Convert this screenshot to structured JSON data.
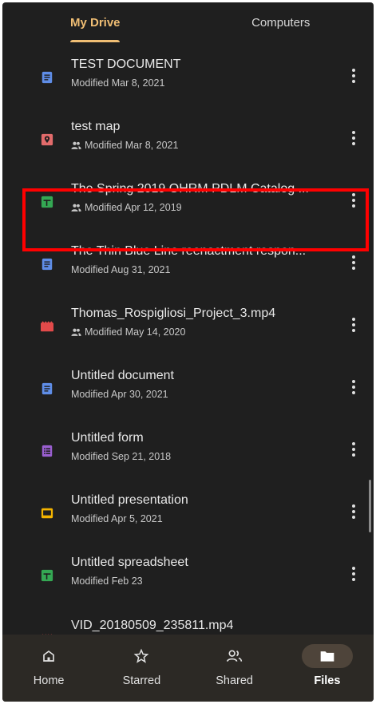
{
  "tabs": [
    {
      "label": "My Drive",
      "active": true
    },
    {
      "label": "Computers",
      "active": false
    }
  ],
  "files": [
    {
      "title": "TEST DOCUMENT",
      "meta": "Modified Mar 8, 2021",
      "shared": false,
      "type": "doc",
      "icon": "docs-icon"
    },
    {
      "title": "test map",
      "meta": "Modified Mar 8, 2021",
      "shared": true,
      "type": "map",
      "icon": "map-pin-icon"
    },
    {
      "title": "The Spring 2019 OHRM PDLM Catalog ...",
      "meta": "Modified Apr 12, 2019",
      "shared": true,
      "type": "sheet",
      "icon": "sheets-icon"
    },
    {
      "title": "The Thin Blue Line reenactment respon...",
      "meta": "Modified Aug 31, 2021",
      "shared": false,
      "type": "doc",
      "icon": "docs-icon"
    },
    {
      "title": "Thomas_Rospigliosi_Project_3.mp4",
      "meta": "Modified May 14, 2020",
      "shared": true,
      "type": "video",
      "icon": "video-icon"
    },
    {
      "title": "Untitled document",
      "meta": "Modified Apr 30, 2021",
      "shared": false,
      "type": "doc",
      "icon": "docs-icon"
    },
    {
      "title": "Untitled form",
      "meta": "Modified Sep 21, 2018",
      "shared": false,
      "type": "form",
      "icon": "forms-icon"
    },
    {
      "title": "Untitled presentation",
      "meta": "Modified Apr 5, 2021",
      "shared": false,
      "type": "slides",
      "icon": "slides-icon"
    },
    {
      "title": "Untitled spreadsheet",
      "meta": "Modified Feb 23",
      "shared": false,
      "type": "sheet",
      "icon": "sheets-icon"
    },
    {
      "title": "VID_20180509_235811.mp4",
      "meta": "",
      "shared": false,
      "type": "video",
      "icon": "video-icon"
    }
  ],
  "nav": [
    {
      "label": "Home",
      "icon": "home-icon",
      "active": false
    },
    {
      "label": "Starred",
      "icon": "star-icon",
      "active": false
    },
    {
      "label": "Shared",
      "icon": "people-icon",
      "active": false
    },
    {
      "label": "Files",
      "icon": "folder-icon",
      "active": true
    }
  ],
  "colors": {
    "background": "#1f1f1f",
    "accent": "#f0be74",
    "doc": "#5f8de7",
    "map": "#e26b6b",
    "sheet": "#34a853",
    "video": "#e24a4a",
    "form": "#9a5fd0",
    "slides": "#f4b400",
    "highlight": "#ff0000"
  }
}
